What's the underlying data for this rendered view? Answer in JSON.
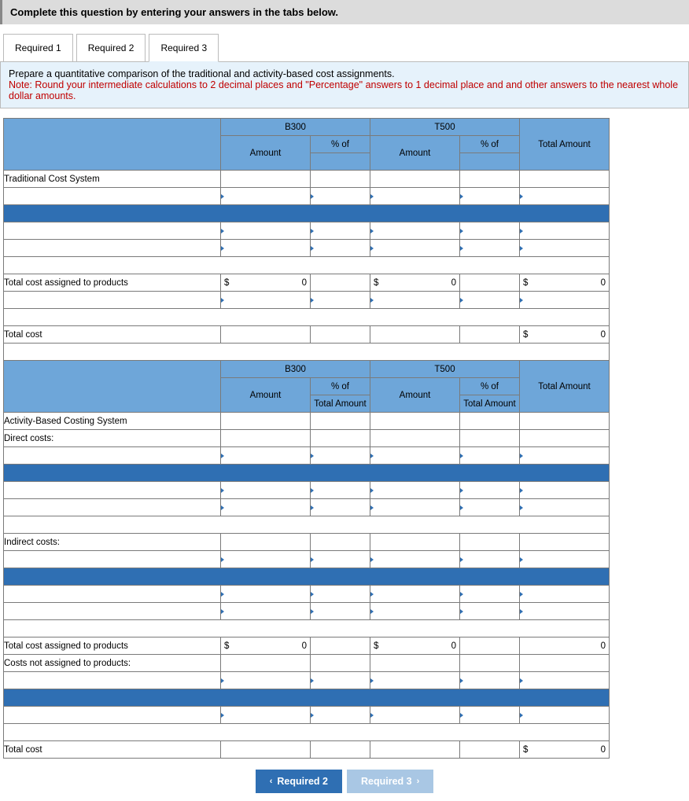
{
  "instruction": "Complete this question by entering your answers in the tabs below.",
  "tabs": {
    "t1": "Required 1",
    "t2": "Required 2",
    "t3": "Required 3"
  },
  "question": {
    "line1": "Prepare a quantitative comparison of the traditional and activity-based cost assignments.",
    "note": "Note: Round your intermediate calculations to 2 decimal places and \"Percentage\" answers to 1 decimal place and and other answers to the nearest whole dollar amounts."
  },
  "headers": {
    "b300": "B300",
    "t500": "T500",
    "amount": "Amount",
    "pct": "% of",
    "totalAmount": "Total Amount",
    "pctTotal1": "% of",
    "pctTotal2": "Total Amount"
  },
  "rows": {
    "traditional": "Traditional Cost System",
    "totalAssigned": "Total cost assigned to products",
    "totalCost": "Total cost",
    "abc": "Activity-Based Costing System",
    "direct": "Direct costs:",
    "indirect": "Indirect costs:",
    "notAssigned": "Costs not assigned to products:"
  },
  "vals": {
    "dollar": "$",
    "zero": "0"
  },
  "nav": {
    "prev": "Required 2",
    "next": "Required 3"
  }
}
